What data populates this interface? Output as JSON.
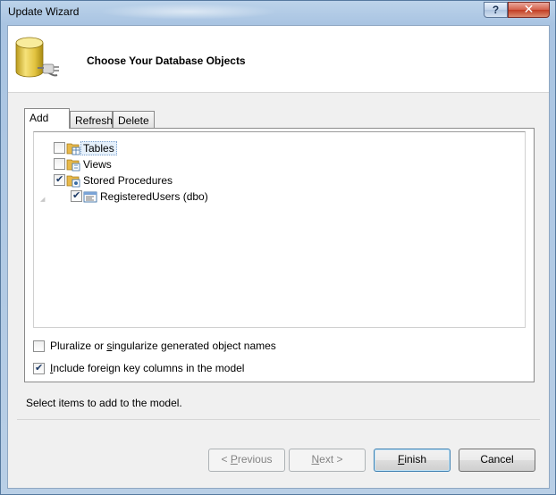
{
  "window": {
    "title": "Update Wizard",
    "help_label": "?",
    "close_label": "✕"
  },
  "header": {
    "title": "Choose Your Database Objects"
  },
  "tabs": [
    {
      "label": "Add",
      "active": true
    },
    {
      "label": "Refresh",
      "active": false
    },
    {
      "label": "Delete",
      "active": false
    }
  ],
  "tree": {
    "items": [
      {
        "label": "Tables",
        "checked": false,
        "selected": true
      },
      {
        "label": "Views",
        "checked": false
      },
      {
        "label": "Stored Procedures",
        "checked": true
      },
      {
        "label": "RegisteredUsers (dbo)",
        "checked": true
      }
    ]
  },
  "options": {
    "pluralize": {
      "label_pre": "Pluralize or ",
      "label_u": "s",
      "label_post": "ingularize generated object names",
      "checked": false
    },
    "foreign_keys": {
      "label_pre": "",
      "label_u": "I",
      "label_post": "nclude foreign key columns in the model",
      "checked": true
    }
  },
  "status": "Select items to add to the model.",
  "buttons": {
    "previous": {
      "pre": "< ",
      "u": "P",
      "post": "revious",
      "enabled": false
    },
    "next": {
      "pre": "",
      "u": "N",
      "post": "ext >",
      "enabled": false
    },
    "finish": {
      "pre": "",
      "u": "F",
      "post": "inish",
      "enabled": true
    },
    "cancel": {
      "label": "Cancel",
      "enabled": true
    }
  },
  "colors": {
    "accent": "#3c7fb1",
    "selection": "#e5f0fb",
    "folder": "#e8b94a"
  }
}
